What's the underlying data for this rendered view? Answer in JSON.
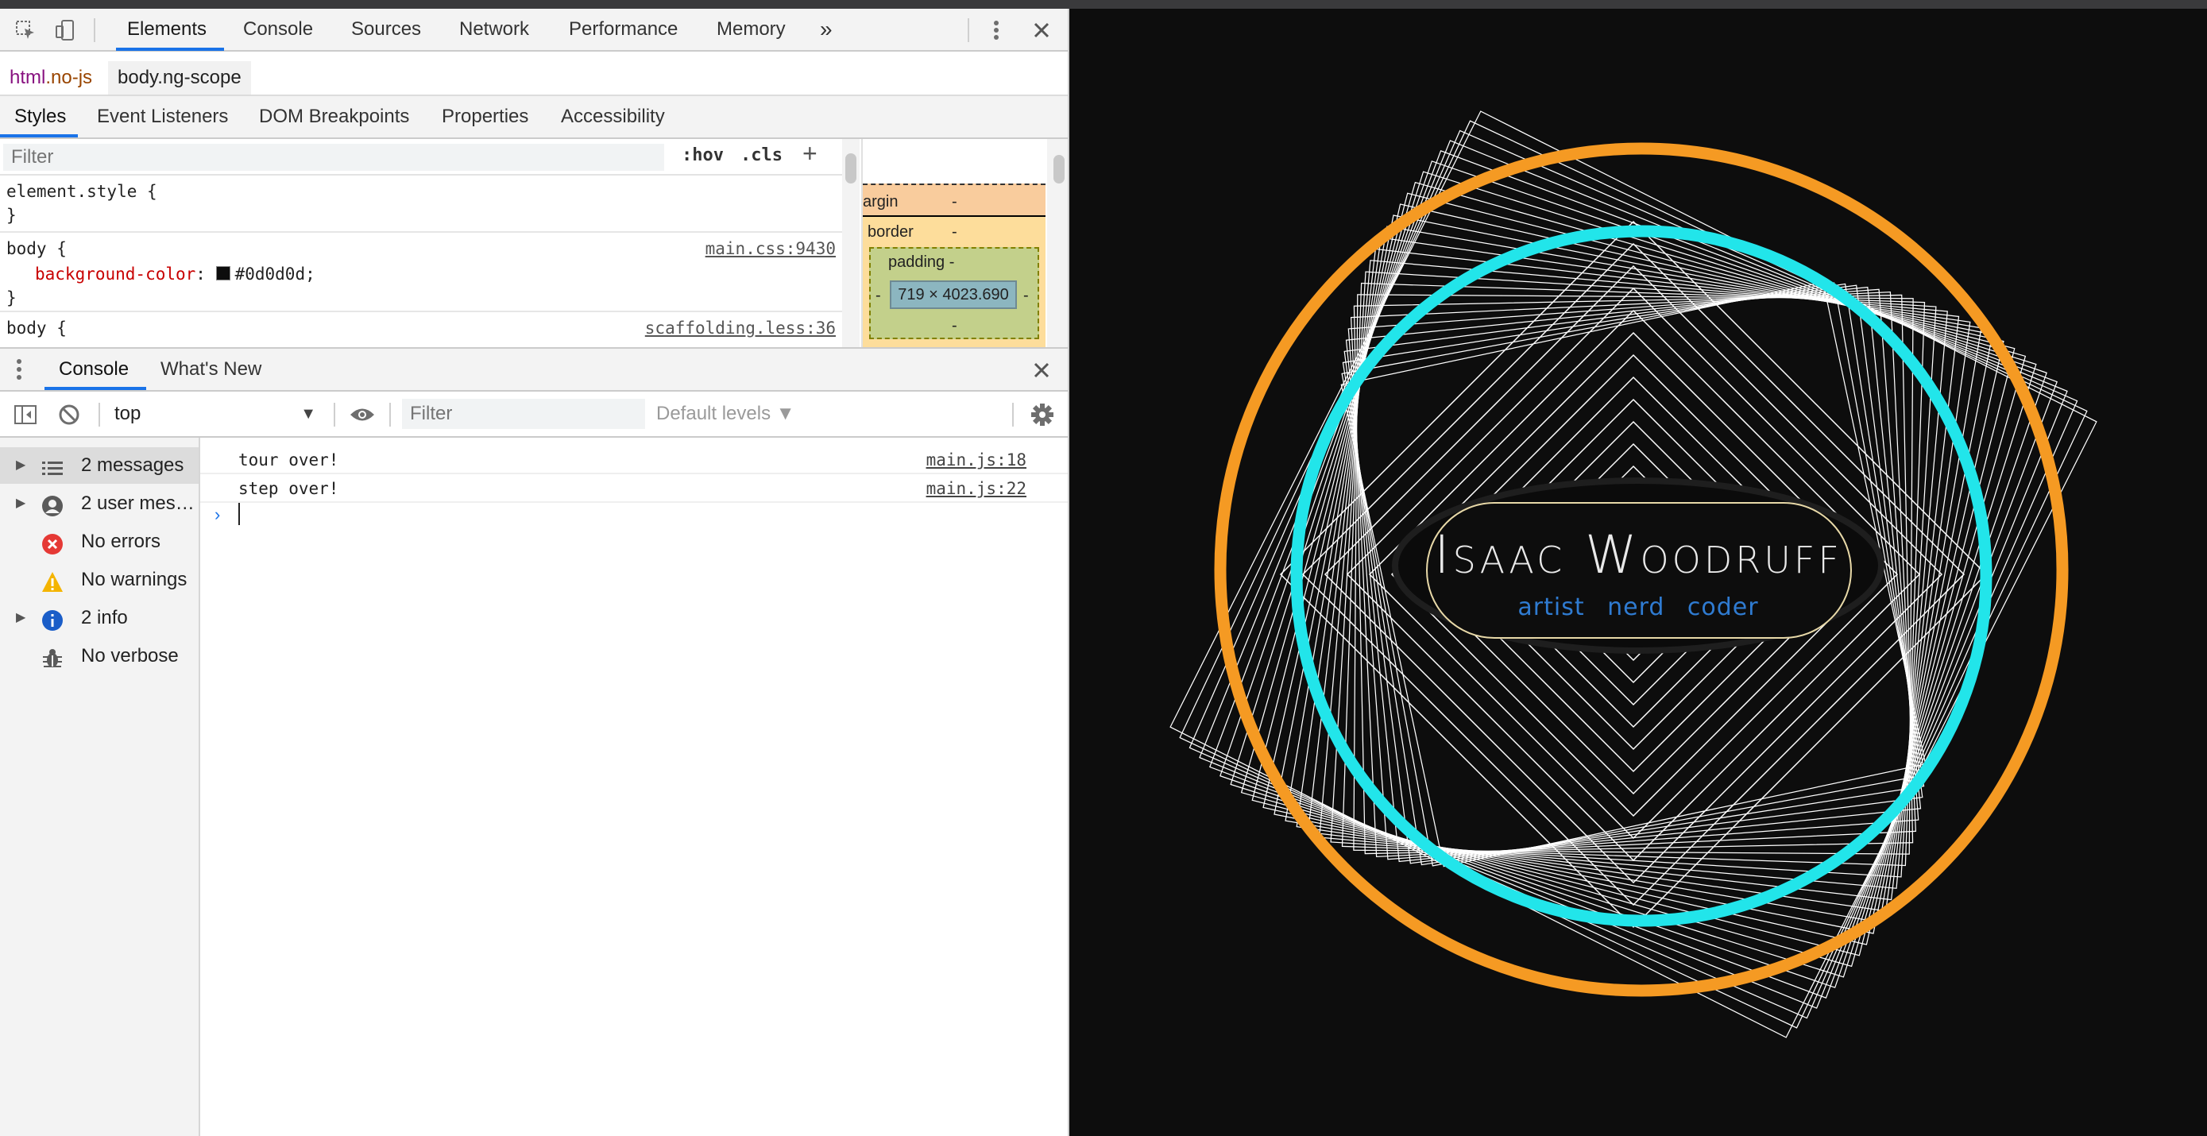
{
  "devtools": {
    "main_tabs": [
      "Elements",
      "Console",
      "Sources",
      "Network",
      "Performance",
      "Memory"
    ],
    "overflow_label": "»",
    "breadcrumbs": {
      "html_tag": "html",
      "html_class": ".no-js",
      "body": "body.ng-scope"
    },
    "subtabs": [
      "Styles",
      "Event Listeners",
      "DOM Breakpoints",
      "Properties",
      "Accessibility"
    ],
    "styles": {
      "filter_placeholder": "Filter",
      "hov": ":hov",
      "cls": ".cls",
      "add": "+",
      "rule1_selector": "element.style {",
      "rule1_close": "}",
      "rule2_selector": "body {",
      "rule2_source": "main.css:9430",
      "rule2_prop": "background-color",
      "rule2_value": "#0d0d0d;",
      "rule2_close": "}",
      "rule3_selector": "body {",
      "rule3_source": "scaffolding.less:36"
    },
    "box_model": {
      "margin_label": "argin",
      "margin_value": "-",
      "border_label": "border",
      "border_value": "-",
      "padding_label": "padding -",
      "padding_left": "-",
      "padding_right": "-",
      "padding_bottom": "-",
      "content": "719 × 4023.690"
    },
    "drawer_tabs": [
      "Console",
      "What's New"
    ],
    "console": {
      "context": "top",
      "filter_placeholder": "Filter",
      "levels": "Default levels ▼",
      "sidebar": [
        {
          "label": "2 messages",
          "icon": "list-icon",
          "expandable": true
        },
        {
          "label": "2 user mes…",
          "icon": "user-icon",
          "expandable": true
        },
        {
          "label": "No errors",
          "icon": "error-icon",
          "expandable": false
        },
        {
          "label": "No warnings",
          "icon": "warning-icon",
          "expandable": false
        },
        {
          "label": "2 info",
          "icon": "info-icon",
          "expandable": true
        },
        {
          "label": "No verbose",
          "icon": "bug-icon",
          "expandable": false
        }
      ],
      "messages": [
        {
          "text": "tour over!",
          "source": "main.js:18"
        },
        {
          "text": "step over!",
          "source": "main.js:22"
        }
      ],
      "prompt": "›"
    }
  },
  "page": {
    "name": "Isaac Woodruff",
    "tags": [
      "artist",
      "nerd",
      "coder"
    ],
    "colors": {
      "background": "#0d0d0d",
      "outer_ring": "#f59a23",
      "inner_ring": "#22e5ea",
      "tags": "#2f7bd1",
      "frame": "#e8d9a8"
    }
  }
}
